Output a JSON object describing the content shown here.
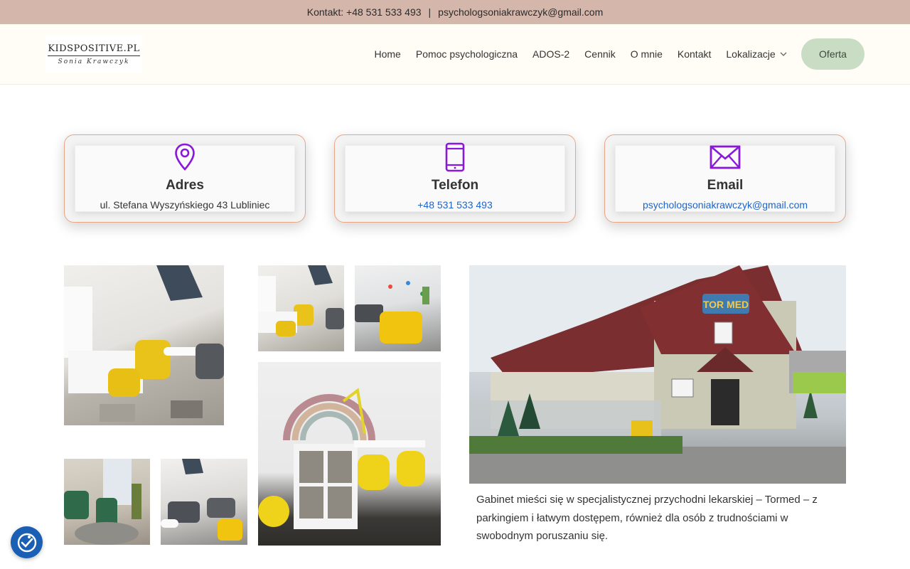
{
  "topbar": {
    "contact_label": "Kontakt: +48 531 533 493",
    "separator": "|",
    "email": "psychologsoniakrawczyk@gmail.com"
  },
  "logo": {
    "main": "KIDSPOSITIVE.PL",
    "signature": "Sonia Krawczyk"
  },
  "nav": {
    "items": [
      "Home",
      "Pomoc psychologiczna",
      "ADOS-2",
      "Cennik",
      "O mnie",
      "Kontakt",
      "Lokalizacje"
    ],
    "cta": "Oferta"
  },
  "cards": [
    {
      "icon": "location-pin-icon",
      "title": "Adres",
      "text": "ul. Stefana Wyszyńskiego 43 Lubliniec"
    },
    {
      "icon": "phone-icon",
      "title": "Telefon",
      "text": "+48 531 533 493"
    },
    {
      "icon": "envelope-icon",
      "title": "Email",
      "text": "psychologsoniakrawczyk@gmail.com"
    }
  ],
  "building_sign": "TOR MED",
  "description": "Gabinet mieści się w specjalistycznej przychodni lekarskiej – Tormed – z parkingiem i łatwym dostępem, również dla osób z trudnościami w swobodnym poruszaniu się.",
  "colors": {
    "topbar": "#d4b6ab",
    "header": "#fffdf5",
    "accent_purple": "#8a18d8",
    "link_blue": "#1e63c9",
    "cta_green": "#c9dcc4",
    "a11y_blue": "#1a5fb4"
  }
}
